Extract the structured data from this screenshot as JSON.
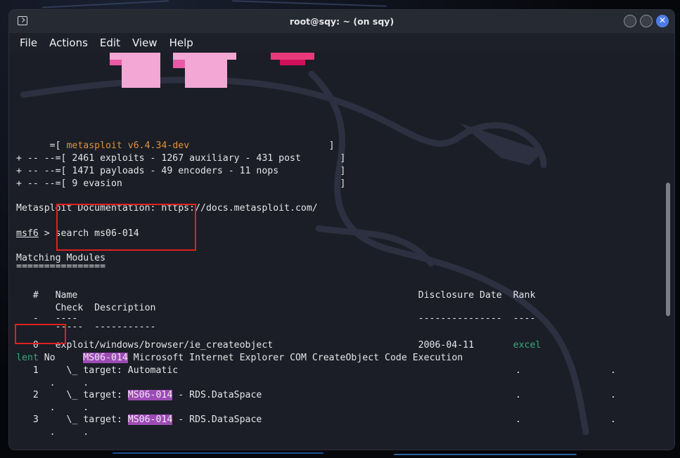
{
  "window": {
    "title": "root@sqy: ~ (on sqy)"
  },
  "menu": [
    "File",
    "Actions",
    "Edit",
    "View",
    "Help"
  ],
  "banner": {
    "version_prefix": "      =[ ",
    "version": "metasploit v6.4.34-dev",
    "version_suffix": "                         ]",
    "stats": [
      "+ -- --=[ 2461 exploits - 1267 auxiliary - 431 post       ]",
      "+ -- --=[ 1471 payloads - 49 encoders - 11 nops           ]",
      "+ -- --=[ 9 evasion                                       ]"
    ]
  },
  "doc_line": "Metasploit Documentation: https://docs.metasploit.com/",
  "prompt": {
    "name": "msf6",
    "sep": " > ",
    "command": "search ms06-014"
  },
  "matching": {
    "title": "Matching Modules",
    "underline": "================"
  },
  "table": {
    "header1": "   #   Name                                                             Disclosure Date  Rank",
    "header2": "       Check  Description",
    "under1": "   -   ----                                                             ---------------  ----",
    "under2": "       -----  -----------",
    "rows": [
      {
        "line1": "   0   exploit/windows/browser/ie_createobject                          2006-04-11       ",
        "rank_a": "excel",
        "rank_b": "lent",
        "check": " No     ",
        "hl": "MS06-014",
        "desc": " Microsoft Internet Explorer COM CreateObject Code Execution"
      },
      {
        "line1": "   1     \\_ target: Automatic",
        "dots": ".                ."
      },
      {
        "line1_pre": "   2     \\_ target: ",
        "hl": "MS06-014",
        "line1_post": " - RDS.DataSpace",
        "dots": ".                ."
      },
      {
        "line1_pre": "   3     \\_ target: ",
        "hl": "MS06-014",
        "line1_post": " - RDS.DataSpace",
        "dots": ".                ."
      }
    ],
    "sub_dots": "      .     ."
  }
}
